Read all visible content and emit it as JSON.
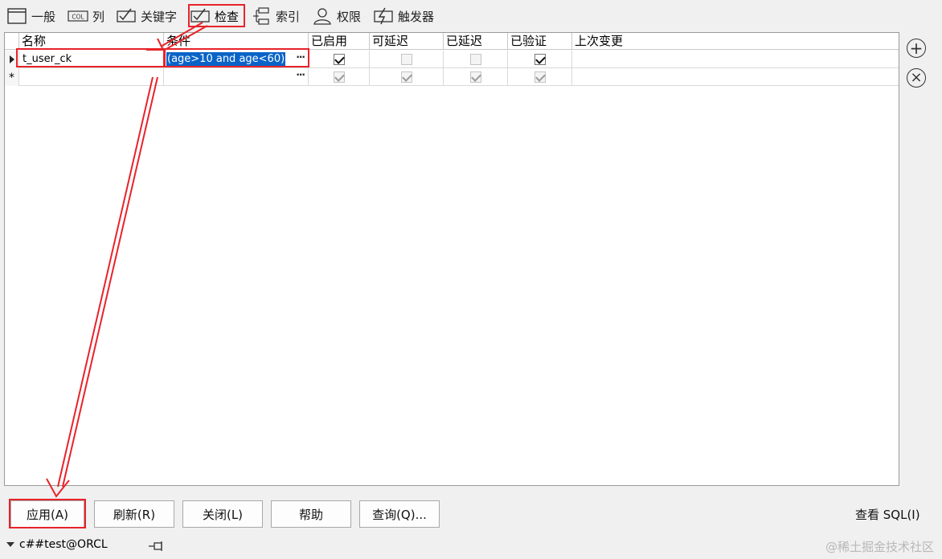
{
  "tabs": [
    {
      "label": "一般",
      "icon": "window-icon"
    },
    {
      "label": "列",
      "icon": "col-icon",
      "icon_text": "COL"
    },
    {
      "label": "关键字",
      "icon": "check-box-icon"
    },
    {
      "label": "检查",
      "icon": "check-box-icon",
      "active": true
    },
    {
      "label": "索引",
      "icon": "tree-icon"
    },
    {
      "label": "权限",
      "icon": "user-icon"
    },
    {
      "label": "触发器",
      "icon": "trigger-icon"
    }
  ],
  "grid": {
    "columns": [
      "名称",
      "条件",
      "已启用",
      "可延迟",
      "已延迟",
      "已验证",
      "上次变更"
    ],
    "rows": [
      {
        "indicator": "current",
        "name": "t_user_ck",
        "condition": "(age>10 and age<60)",
        "enabled": true,
        "deferrable": false,
        "deferred": false,
        "validated": true,
        "last_change": ""
      },
      {
        "indicator": "new",
        "indicator_text": "*",
        "name": "",
        "condition": "",
        "enabled": true,
        "deferrable": true,
        "deferred": true,
        "validated": true,
        "last_change": ""
      }
    ],
    "ellipsis": "···"
  },
  "side_buttons": {
    "add": "+",
    "remove": "×"
  },
  "buttons": {
    "apply": "应用(A)",
    "refresh": "刷新(R)",
    "close": "关闭(L)",
    "help": "帮助",
    "query": "查询(Q)...",
    "view_sql": "查看 SQL(I)"
  },
  "status": {
    "connection": "c##test@ORCL",
    "watermark": "@稀土掘金技术社区"
  },
  "colors": {
    "annotation": "#e8232a",
    "selection": "#0a64c8"
  }
}
